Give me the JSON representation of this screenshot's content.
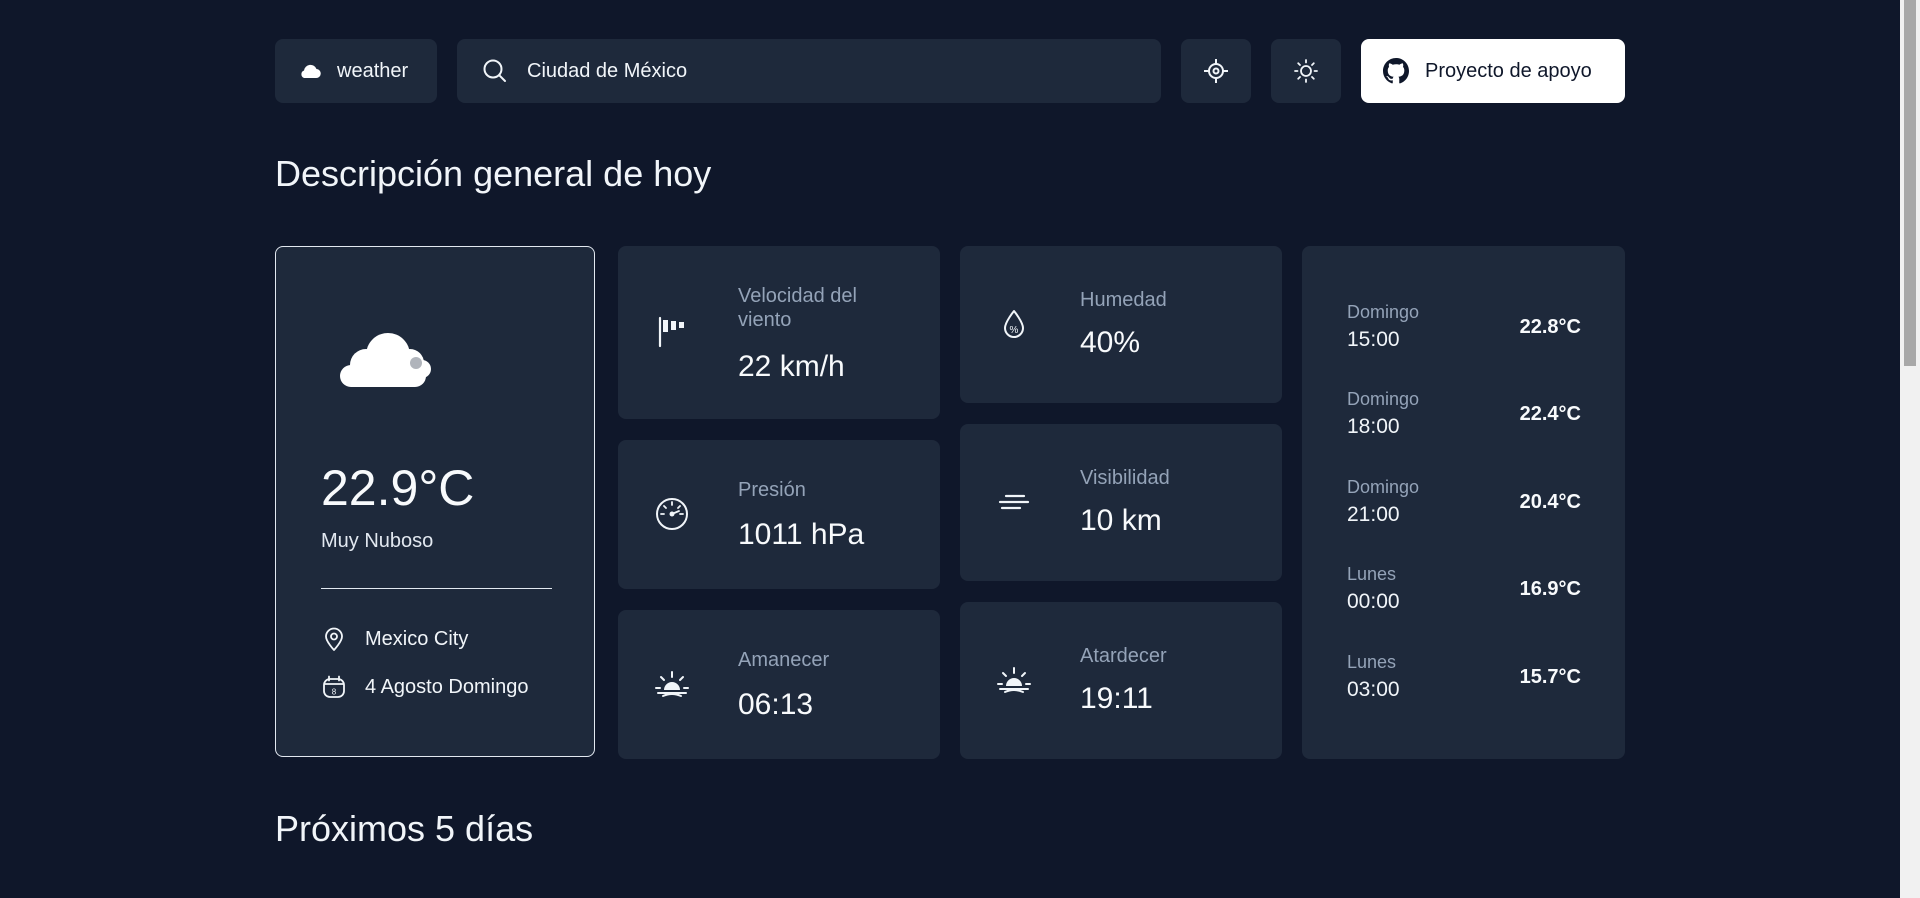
{
  "header": {
    "logo_text": "weather",
    "search_value": "Ciudad de México",
    "support_label": "Proyecto de apoyo"
  },
  "sections": {
    "today_title": "Descripción general de hoy",
    "next_title": "Próximos 5 días"
  },
  "current": {
    "icon": "cloud-icon",
    "temperature": "22.9°C",
    "description": "Muy Nuboso",
    "location": "Mexico City",
    "date": "4 Agosto Domingo",
    "date_icon_day": "8"
  },
  "metrics": [
    {
      "id": "wind",
      "icon": "windsock-icon",
      "label": "Velocidad del viento",
      "value": "22 km/h"
    },
    {
      "id": "pressure",
      "icon": "gauge-icon",
      "label": "Presión",
      "value": "1011 hPa"
    },
    {
      "id": "sunrise",
      "icon": "sunrise-icon",
      "label": "Amanecer",
      "value": "06:13"
    },
    {
      "id": "humidity",
      "icon": "humidity-icon",
      "label": "Humedad",
      "value": "40%"
    },
    {
      "id": "visibility",
      "icon": "visibility-icon",
      "label": "Visibilidad",
      "value": "10 km"
    },
    {
      "id": "sunset",
      "icon": "sunset-icon",
      "label": "Atardecer",
      "value": "19:11"
    }
  ],
  "hourly": [
    {
      "day": "Domingo",
      "time": "15:00",
      "temp": "22.8°C"
    },
    {
      "day": "Domingo",
      "time": "18:00",
      "temp": "22.4°C"
    },
    {
      "day": "Domingo",
      "time": "21:00",
      "temp": "20.4°C"
    },
    {
      "day": "Lunes",
      "time": "00:00",
      "temp": "16.9°C"
    },
    {
      "day": "Lunes",
      "time": "03:00",
      "temp": "15.7°C"
    }
  ],
  "colors": {
    "background": "#0f172a",
    "card": "#1e293b",
    "muted_text": "#94a3b8",
    "text": "#f1f5f9",
    "button_light": "#ffffff"
  }
}
